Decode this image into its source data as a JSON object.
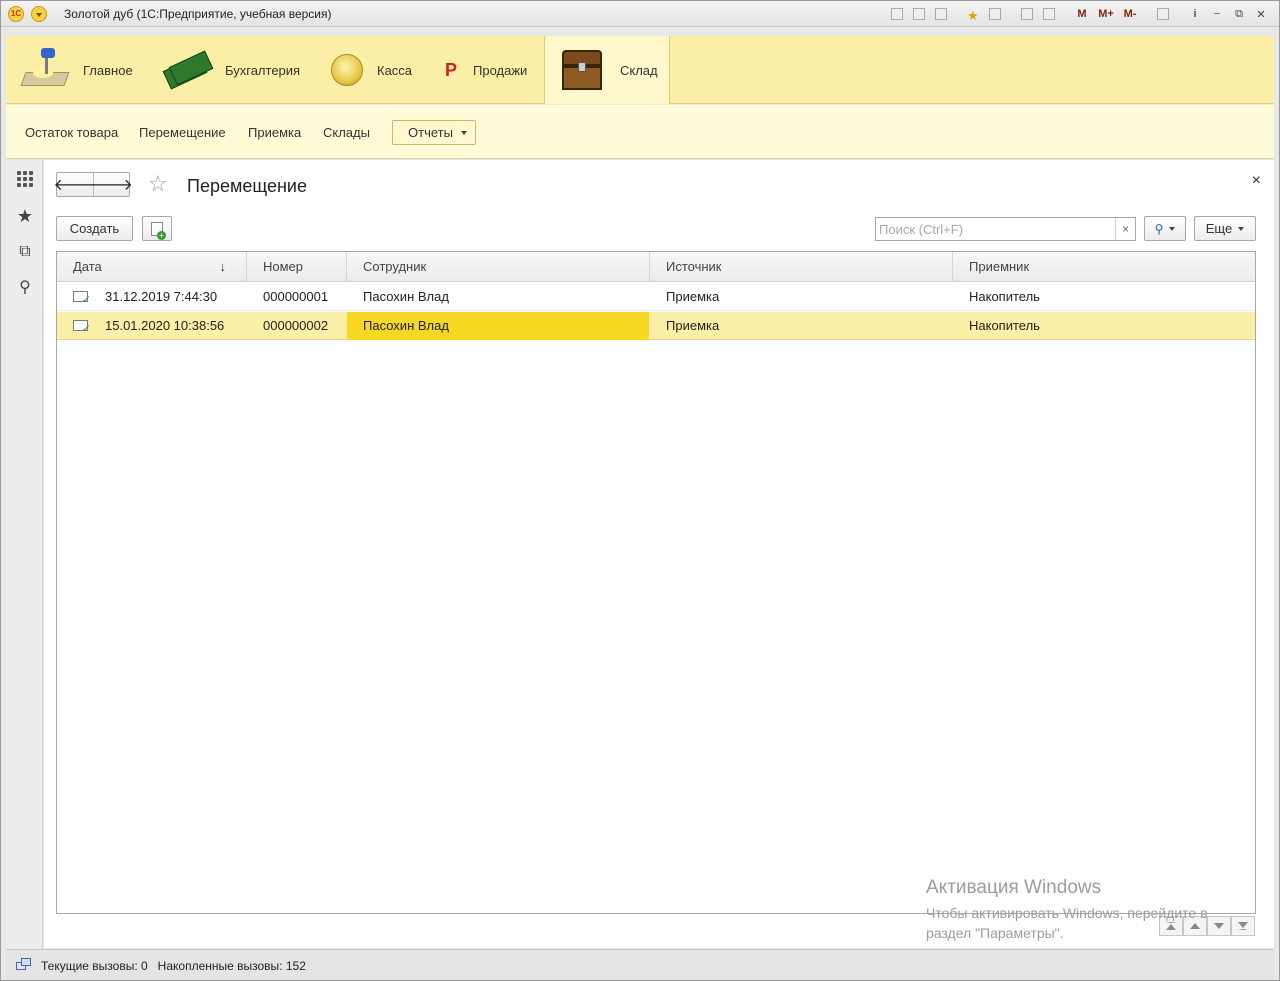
{
  "window": {
    "title": "Золотой дуб  (1С:Предприятие, учебная версия)"
  },
  "toolbar_icons": [
    "save-icon",
    "print-icon",
    "print-preview-icon",
    "add-favorite-icon",
    "favorites-icon",
    "calculator-icon",
    "calendar-icon",
    "M",
    "M+",
    "M-",
    "panels-icon",
    "info-icon",
    "minimize-icon",
    "restore-icon",
    "close-icon"
  ],
  "title_tools": {
    "m": "M",
    "m_plus": "M+",
    "m_minus": "M-",
    "info": "i",
    "minimize": "−",
    "restore": "⧉",
    "close": "✕"
  },
  "sections": [
    {
      "label": "Главное",
      "icon": "desk-lamp-icon"
    },
    {
      "label": "Бухгалтерия",
      "icon": "money-icon"
    },
    {
      "label": "Касса",
      "icon": "coin-icon"
    },
    {
      "label": "Продажи",
      "icon": "ruble-icon",
      "glyph": "Р"
    },
    {
      "label": "Склад",
      "icon": "chest-icon",
      "active": true
    }
  ],
  "function_panel": {
    "links": [
      "Остаток товара",
      "Перемещение",
      "Приемка",
      "Склады"
    ],
    "reports_button": "Отчеты"
  },
  "tool_panel": [
    "menu-grid-icon",
    "favorites-star-icon",
    "history-icon",
    "search-icon"
  ],
  "form": {
    "title": "Перемещение",
    "back": "🡐",
    "forward": "🡒",
    "star": "☆",
    "close": "×",
    "create_button": "Создать",
    "search": {
      "placeholder": "Поиск (Ctrl+F)",
      "value": "",
      "clear": "×"
    },
    "more_button": "Еще",
    "search_button_icon": "🔍"
  },
  "table": {
    "columns": [
      {
        "label": "Дата",
        "sort": "↓"
      },
      {
        "label": "Номер"
      },
      {
        "label": "Сотрудник"
      },
      {
        "label": "Источник"
      },
      {
        "label": "Приемник"
      }
    ],
    "rows": [
      {
        "date": "31.12.2019 7:44:30",
        "number": "000000001",
        "employee": "Пасохин Влад",
        "source": "Приемка",
        "receiver": "Накопитель",
        "selected": false
      },
      {
        "date": "15.01.2020 10:38:56",
        "number": "000000002",
        "employee": "Пасохин Влад",
        "source": "Приемка",
        "receiver": "Накопитель",
        "selected": true
      }
    ]
  },
  "watermark": {
    "title": "Активация Windows",
    "line1": "Чтобы активировать Windows, перейдите в",
    "line2": "раздел \"Параметры\"."
  },
  "statusbar": {
    "text": "Текущие вызовы: 0   Накопленные вызовы: 152"
  }
}
